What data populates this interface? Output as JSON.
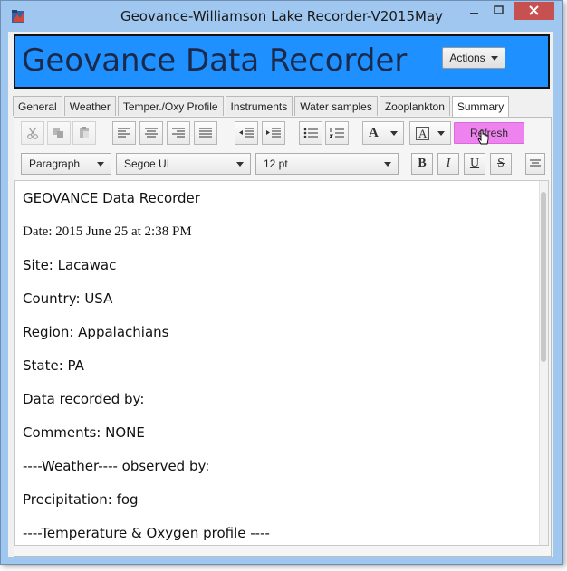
{
  "window": {
    "title": "Geovance-Williamson Lake Recorder-V2015May"
  },
  "header": {
    "title": "Geovance Data Recorder",
    "actions_label": "Actions"
  },
  "tabs": [
    {
      "label": "General"
    },
    {
      "label": "Weather"
    },
    {
      "label": "Temper./Oxy Profile"
    },
    {
      "label": "Instruments"
    },
    {
      "label": "Water samples"
    },
    {
      "label": "Zooplankton"
    },
    {
      "label": "Summary"
    }
  ],
  "toolbar": {
    "refresh_label": "Refresh",
    "paragraph_style": "Paragraph",
    "font_family": "Segoe UI",
    "font_size": "12 pt",
    "bold": "B",
    "italic": "I",
    "underline": "U",
    "strike": "S",
    "font_color_glyph": "A",
    "highlight_glyph": "A"
  },
  "document": {
    "lines": [
      "GEOVANCE Data Recorder",
      "Date: 2015 June 25 at 2:38 PM",
      "Site: Lacawac",
      "Country: USA",
      "Region: Appalachians",
      "State: PA",
      "Data recorded by:",
      "Comments: NONE",
      "----Weather---- observed by:",
      "Precipitation: fog",
      "----Temperature & Oxygen profile ----"
    ]
  },
  "colors": {
    "header_bg": "#1e90ff",
    "refresh_bg": "#ee82ee",
    "window_frame": "#9fc7f0",
    "close_button": "#c75050"
  }
}
